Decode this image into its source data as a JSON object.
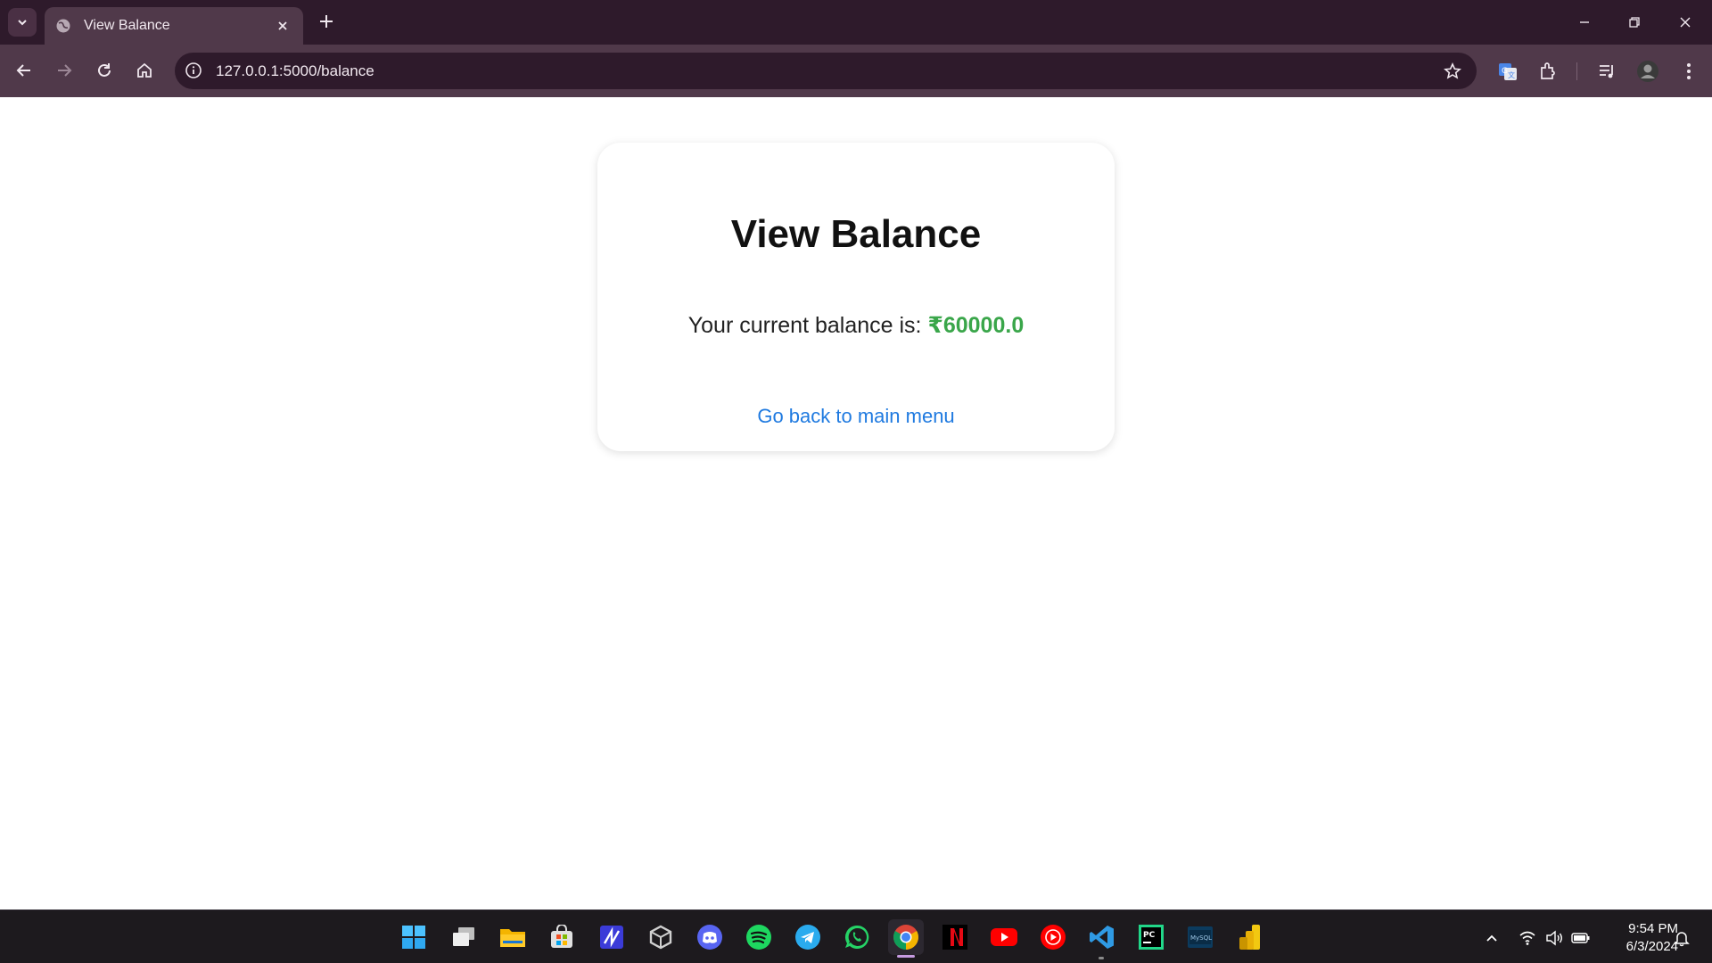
{
  "browser": {
    "tab_title": "View Balance",
    "url": "127.0.0.1:5000/balance"
  },
  "page": {
    "heading": "View Balance",
    "balance_prefix": "Your current balance is: ",
    "balance_amount": "₹60000.0",
    "back_link": "Go back to main menu"
  },
  "taskbar": {
    "apps": [
      "start",
      "task-view",
      "file-explorer",
      "microsoft-store",
      "ide",
      "unity",
      "discord",
      "spotify",
      "telegram",
      "whatsapp",
      "chrome",
      "netflix",
      "youtube",
      "youtube-music",
      "vscode",
      "pycharm",
      "mysql-workbench",
      "power-bi"
    ],
    "active_app": "chrome",
    "time": "9:54 PM",
    "date": "6/3/2024"
  },
  "colors": {
    "chrome_dark": "#2e1a2b",
    "chrome_mid": "#50394a",
    "balance_green": "#3aa64a",
    "link_blue": "#1f7ae0"
  }
}
